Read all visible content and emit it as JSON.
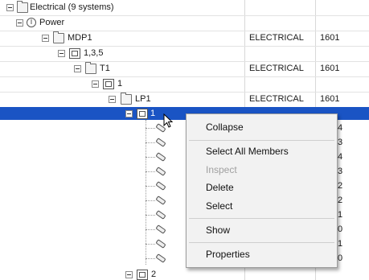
{
  "tree": {
    "root_label": "Electrical (9 systems)",
    "power_label": "Power",
    "mdp1": {
      "label": "MDP1",
      "type": "ELECTRICAL",
      "num": "1601"
    },
    "group_135": {
      "label": "1,3,5"
    },
    "t1": {
      "label": "T1",
      "type": "ELECTRICAL",
      "num": "1601"
    },
    "group_1": {
      "label": "1"
    },
    "lp1": {
      "label": "LP1",
      "type": "ELECTRICAL",
      "num": "1601"
    },
    "selected_circuit": {
      "label": "1"
    },
    "next_circuit": {
      "label": "2"
    },
    "members": [
      {
        "tail": "4"
      },
      {
        "tail": "3"
      },
      {
        "tail": "4"
      },
      {
        "tail": "3"
      },
      {
        "tail": "2"
      },
      {
        "tail": "2"
      },
      {
        "tail": "1"
      },
      {
        "tail": "0"
      },
      {
        "tail": "1"
      },
      {
        "tail": "0"
      }
    ]
  },
  "context_menu": {
    "collapse": "Collapse",
    "select_all_members": "Select All Members",
    "inspect": "Inspect",
    "delete": "Delete",
    "select": "Select",
    "show": "Show",
    "properties": "Properties"
  },
  "colors": {
    "selection": "#1a54c4"
  }
}
